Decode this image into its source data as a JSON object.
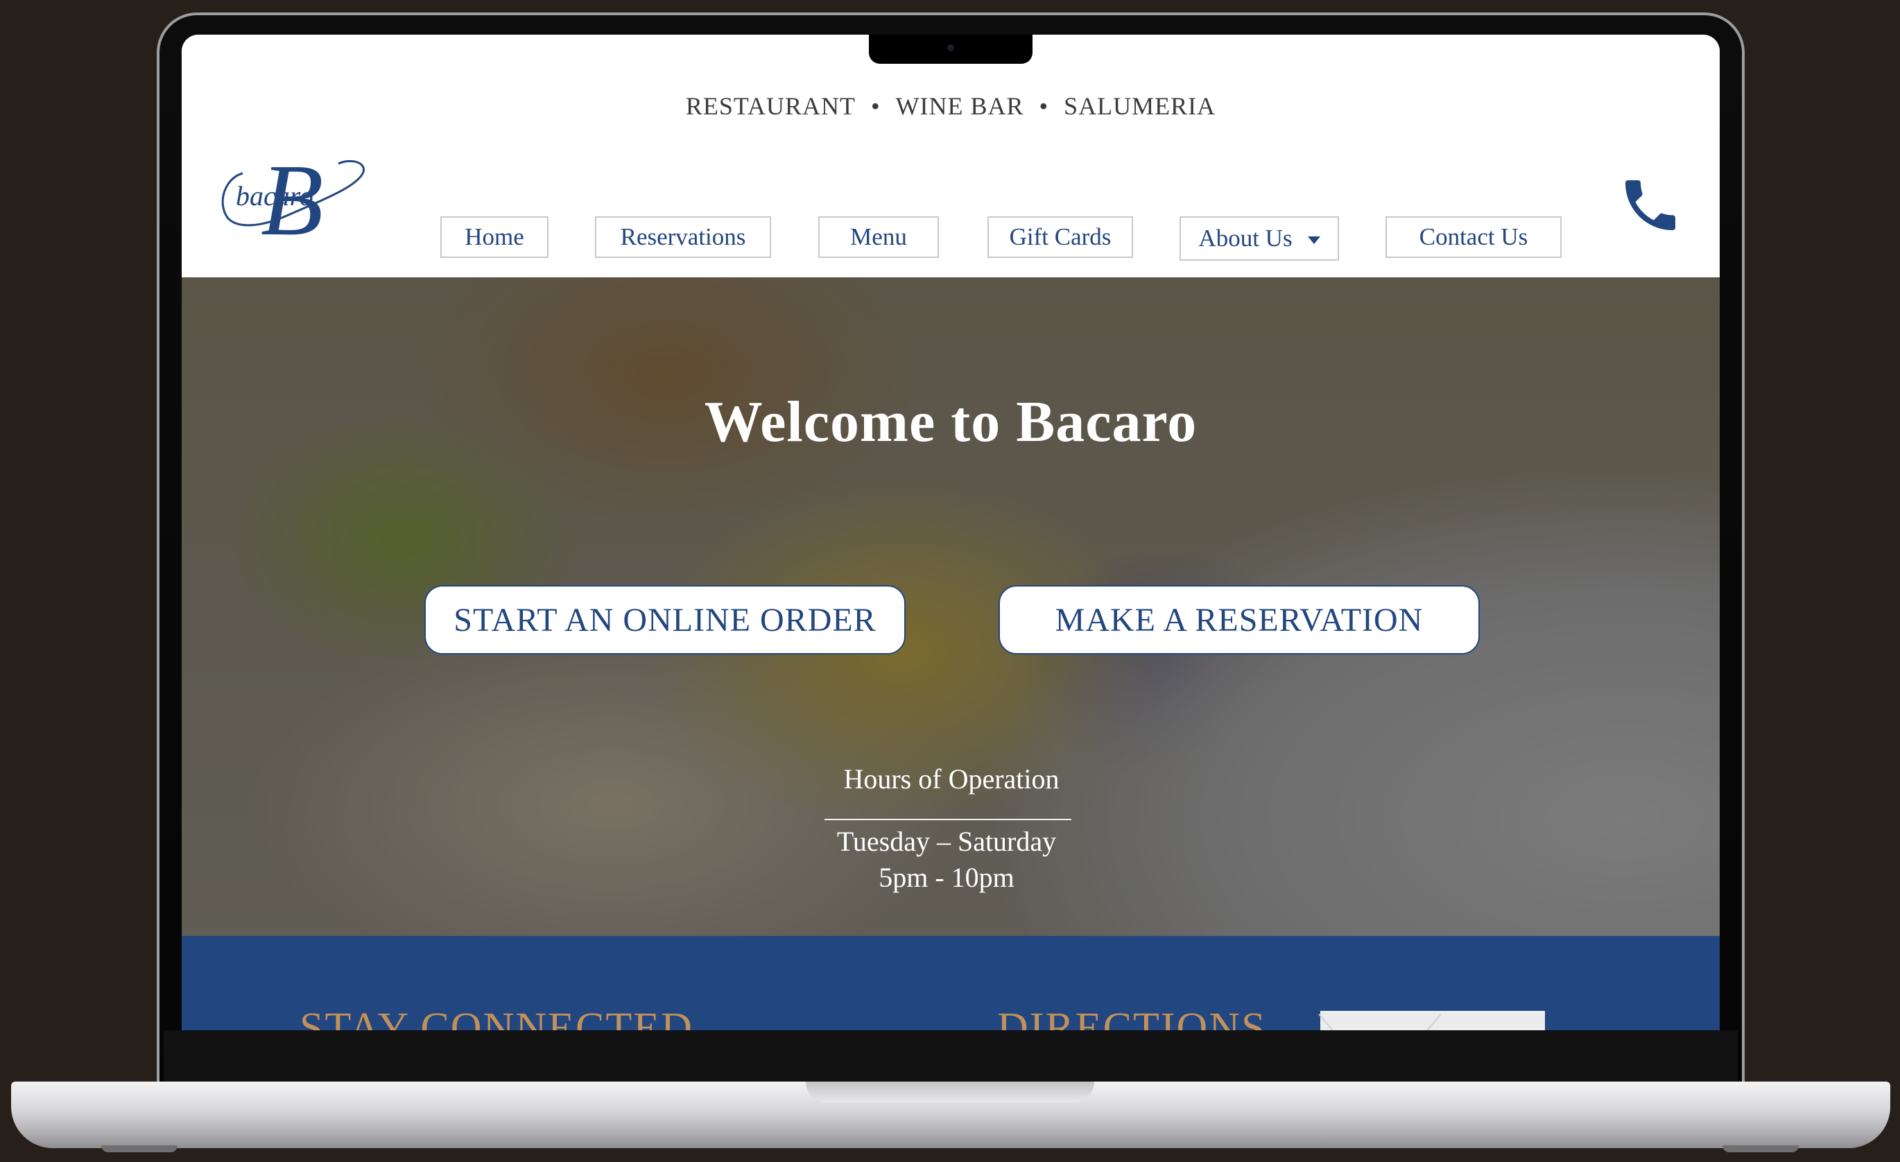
{
  "site": {
    "tagline": [
      "RESTAURANT",
      "WINE BAR",
      "SALUMERIA"
    ],
    "tagline_separator": "•",
    "logo_text": "bacaro",
    "logo_letter": "B"
  },
  "nav": {
    "items": [
      {
        "label": "Home"
      },
      {
        "label": "Reservations"
      },
      {
        "label": "Menu"
      },
      {
        "label": "Gift Cards"
      },
      {
        "label": "About Us",
        "has_dropdown": true
      },
      {
        "label": "Contact Us"
      }
    ],
    "phone_icon": "phone-icon"
  },
  "hero": {
    "title": "Welcome to Bacaro",
    "buttons": {
      "order": "START AN ONLINE ORDER",
      "reserve": "MAKE A RESERVATION"
    },
    "hours": {
      "title": "Hours of Operation",
      "days": "Tuesday – Saturday",
      "time": "5pm - 10pm"
    }
  },
  "footer": {
    "stay_connected": "STAY CONNECTED",
    "directions": "DIRECTIONS"
  },
  "colors": {
    "brand_blue": "#22467f",
    "accent_gold": "#c2915a",
    "background_dark": "#261f1a"
  }
}
